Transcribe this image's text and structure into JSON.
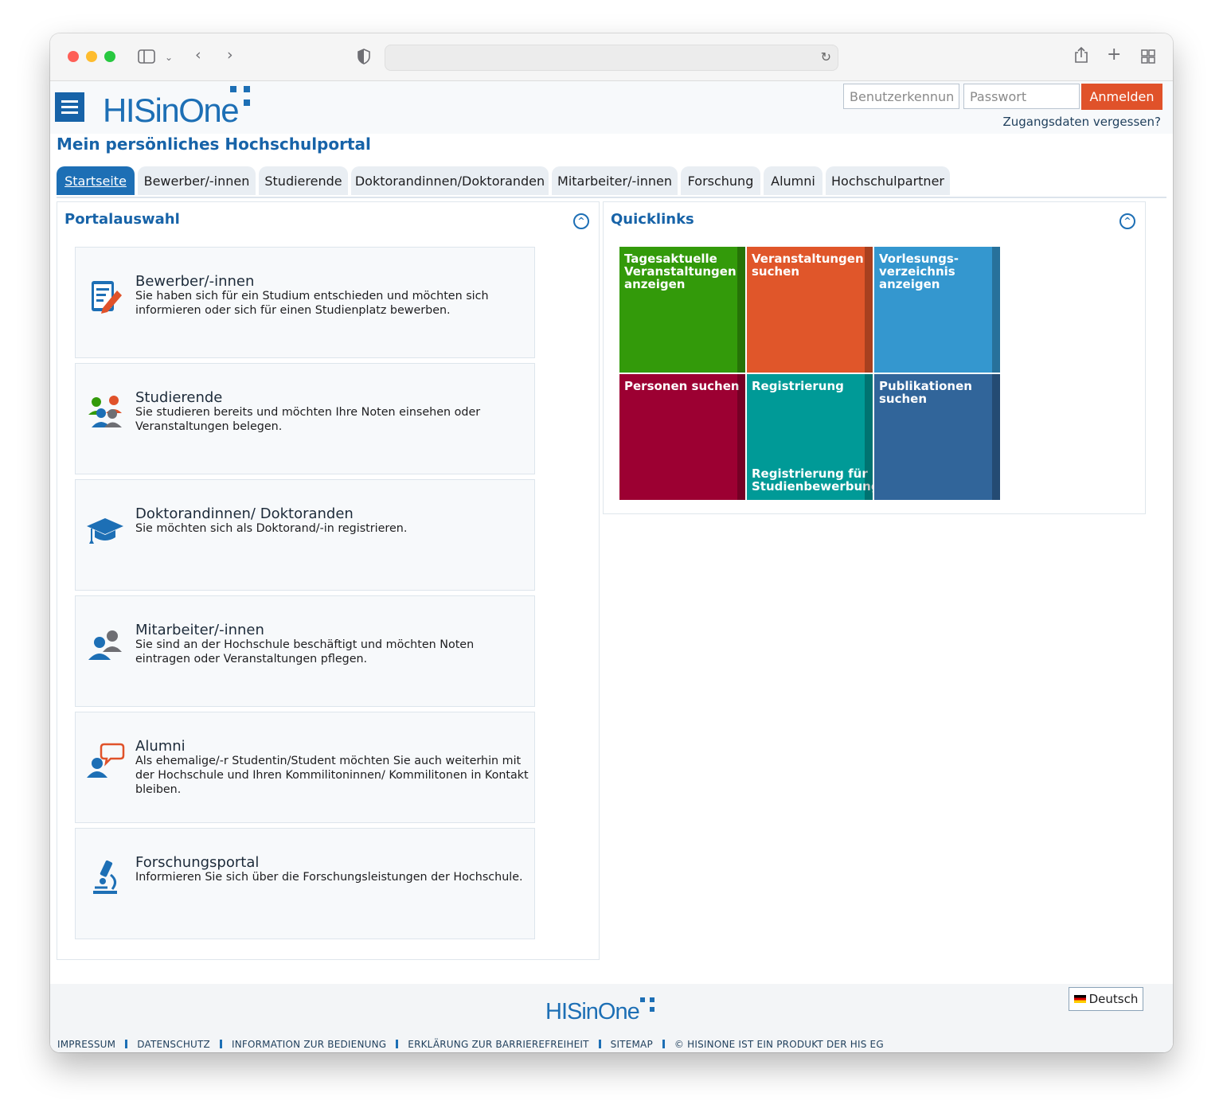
{
  "header": {
    "logo_text": "HISinOne",
    "username_placeholder": "Benutzerkennung",
    "password_placeholder": "Passwort",
    "login_label": "Anmelden",
    "forgot_label": "Zugangsdaten vergessen?"
  },
  "portal_title": "Mein persönliches Hochschulportal",
  "tabs": [
    {
      "label": "Startseite",
      "active": true
    },
    {
      "label": "Bewerber/-innen"
    },
    {
      "label": "Studierende"
    },
    {
      "label": "Doktorandinnen/Doktoranden"
    },
    {
      "label": "Mitarbeiter/-innen"
    },
    {
      "label": "Forschung"
    },
    {
      "label": "Alumni"
    },
    {
      "label": "Hochschulpartner"
    }
  ],
  "portalauswahl": {
    "title": "Portalauswahl",
    "cards": [
      {
        "title": "Bewerber/-innen",
        "desc": "Sie haben sich für ein Studium entschieden und möchten sich informieren oder sich für einen Studienplatz bewerben.",
        "icon": "application-form-icon"
      },
      {
        "title": "Studierende",
        "desc": "Sie studieren bereits und möchten Ihre Noten einsehen oder Veranstaltungen belegen.",
        "icon": "students-group-icon"
      },
      {
        "title": "Doktorandinnen/ Doktoranden",
        "desc": "Sie möchten sich als Doktorand/-in registrieren.",
        "icon": "graduation-cap-icon"
      },
      {
        "title": "Mitarbeiter/-innen",
        "desc": "Sie sind an der Hochschule beschäftigt und möchten Noten eintragen oder Veranstaltungen pflegen.",
        "icon": "staff-icon"
      },
      {
        "title": "Alumni",
        "desc": "Als ehemalige/-r Studentin/Student möchten Sie auch weiterhin mit der Hochschule und Ihren Kommilitoninnen/ Kommilitonen in Kontakt bleiben.",
        "icon": "alumni-chat-icon"
      },
      {
        "title": "Forschungsportal",
        "desc": "Informieren Sie sich über die Forschungsleistungen der Hochschule.",
        "icon": "microscope-icon"
      }
    ]
  },
  "quicklinks": {
    "title": "Quicklinks",
    "tiles": [
      {
        "label": "Tagesaktuelle Veranstaltungen anzeigen",
        "color": "#339a0a"
      },
      {
        "label": "Veranstaltungen suchen",
        "color": "#e0562a"
      },
      {
        "label": "Vorlesungs-verzeichnis anzeigen",
        "color": "#3497cf"
      },
      {
        "label": "Personen suchen",
        "color": "#9c0032"
      },
      {
        "label": "Registrierung",
        "sub": "Registrierung für Studienbewerbung",
        "color": "#009a97"
      },
      {
        "label": "Publikationen suchen",
        "color": "#31659a"
      }
    ]
  },
  "footer": {
    "logo_text": "HISinOne",
    "language": "Deutsch",
    "links": [
      "IMPRESSUM",
      "DATENSCHUTZ",
      "INFORMATION ZUR BEDIENUNG",
      "ERKLÄRUNG ZUR BARRIEREFREIHEIT",
      "SITEMAP",
      "© HISINONE IST EIN PRODUKT DER HIS EG"
    ]
  },
  "colors": {
    "brand_blue": "#1d6fb5",
    "accent_orange": "#e0522a"
  }
}
